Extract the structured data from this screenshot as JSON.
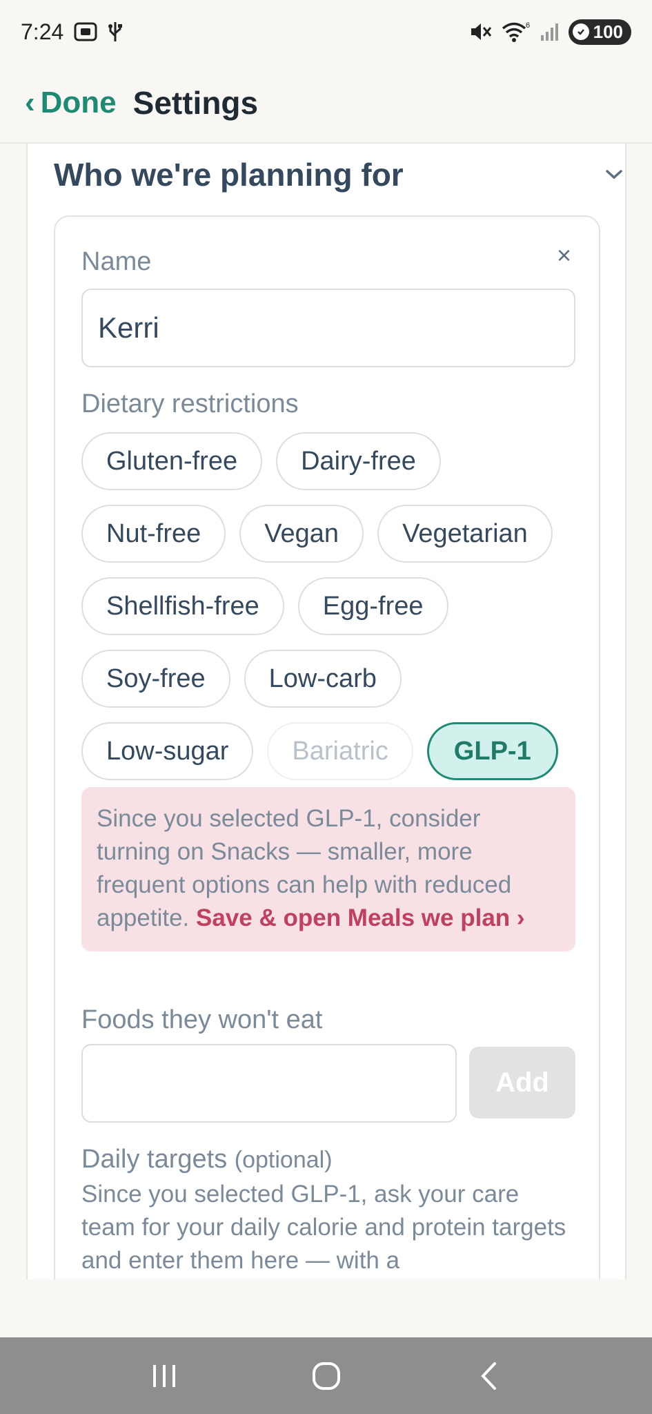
{
  "status_bar": {
    "time": "7:24",
    "battery": "100",
    "wifi_label": "6"
  },
  "header": {
    "back_label": "Done",
    "title": "Settings"
  },
  "section": {
    "title": "Who we're planning for"
  },
  "person": {
    "remove_symbol": "×",
    "name_label": "Name",
    "name_value": "Kerri",
    "dietary_label": "Dietary restrictions",
    "chips": [
      {
        "label": "Gluten-free",
        "state": "normal"
      },
      {
        "label": "Dairy-free",
        "state": "normal"
      },
      {
        "label": "Nut-free",
        "state": "normal"
      },
      {
        "label": "Vegan",
        "state": "normal"
      },
      {
        "label": "Vegetarian",
        "state": "normal"
      },
      {
        "label": "Shellfish-free",
        "state": "normal"
      },
      {
        "label": "Egg-free",
        "state": "normal"
      },
      {
        "label": "Soy-free",
        "state": "normal"
      },
      {
        "label": "Low-carb",
        "state": "normal"
      },
      {
        "label": "Low-sugar",
        "state": "normal"
      },
      {
        "label": "Bariatric",
        "state": "disabled"
      },
      {
        "label": "GLP-1",
        "state": "selected"
      }
    ],
    "notice_text": "Since you selected GLP-1, consider turning on Snacks — smaller, more frequent options can help with reduced appetite.",
    "notice_link": "Save & open Meals we plan ›",
    "foods_label": "Foods they won't eat",
    "foods_placeholder": "",
    "add_label": "Add",
    "targets_label": "Daily targets",
    "targets_optional": "(optional)",
    "targets_text": "Since you selected GLP-1, ask your care team for your daily calorie and protein targets and enter them here — with a"
  },
  "colors": {
    "accent": "#1f8a74",
    "notice_bg": "#f7e1e5",
    "notice_link": "#c0415f",
    "selected_chip_bg": "#d3f1ec"
  },
  "icons": {
    "collapse": "chevron-down-icon",
    "nav_recents": "recents-icon",
    "nav_home": "home-icon",
    "nav_back": "back-icon"
  }
}
